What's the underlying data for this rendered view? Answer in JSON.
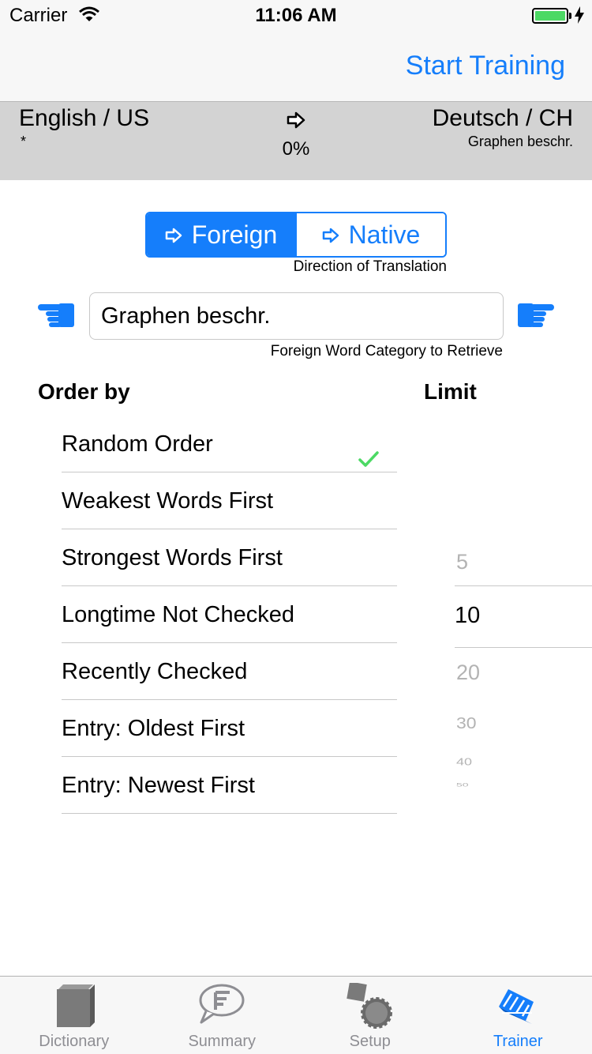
{
  "status_bar": {
    "carrier": "Carrier",
    "time": "11:06 AM"
  },
  "nav": {
    "start_training": "Start Training"
  },
  "languages": {
    "left_name": "English / US",
    "left_sub": "*",
    "progress": "0%",
    "right_name": "Deutsch / CH",
    "right_sub": "Graphen beschr."
  },
  "direction": {
    "foreign": "Foreign",
    "native": "Native",
    "caption": "Direction of Translation"
  },
  "category": {
    "value": "Graphen beschr.",
    "caption": "Foreign Word Category to Retrieve"
  },
  "order": {
    "header": "Order by",
    "items": [
      {
        "label": "Random Order"
      },
      {
        "label": "Weakest Words First"
      },
      {
        "label": "Strongest Words First"
      },
      {
        "label": "Longtime Not Checked"
      },
      {
        "label": "Recently Checked"
      },
      {
        "label": "Entry: Oldest First"
      },
      {
        "label": "Entry: Newest First"
      }
    ],
    "selected": "Random Order"
  },
  "limit": {
    "header": "Limit",
    "options": [
      "5",
      "10",
      "20",
      "30",
      "40",
      "50"
    ],
    "selected": "10"
  },
  "tabs": [
    {
      "label": "Dictionary",
      "icon": "book-icon"
    },
    {
      "label": "Summary",
      "icon": "speech-bubble-icon"
    },
    {
      "label": "Setup",
      "icon": "gears-icon"
    },
    {
      "label": "Trainer",
      "icon": "trainer-icon"
    }
  ],
  "active_tab": "Trainer",
  "colors": {
    "accent": "#157efb",
    "band": "#d3d3d3",
    "check": "#4cd964",
    "picker_dim": "#b3b3b3"
  }
}
